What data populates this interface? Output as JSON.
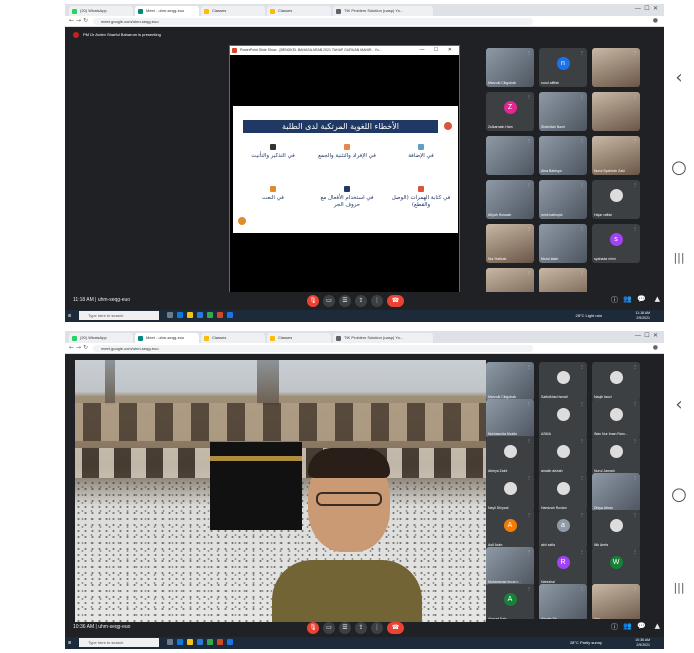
{
  "android_nav": {
    "back": "‹",
    "home": "○",
    "recents": "|||"
  },
  "top": {
    "tabs": [
      {
        "label": "(20) WhatsApp",
        "color": "#25d366"
      },
      {
        "label": "Meet - uhm-seqg-euo",
        "color": "#00897b"
      },
      {
        "label": "Classes",
        "color": "#fbbc04"
      },
      {
        "label": "Classes",
        "color": "#fbbc04"
      },
      {
        "label": "TIK Problem Solution (uasp) Yo...",
        "color": "#5f6368"
      }
    ],
    "url": "meet.google.com/uhm-seqg-euo",
    "banner": "PM Dr Arden Sharful Baharum is presenting",
    "ppt_title": "PowerPoint Slide Show - [BENGKEL BAHASA ARAB 2021 TAHAP GURUAN MAHIR - Yo...",
    "ppt_controls": "— ☐ ✕",
    "slide": {
      "title": "الأخطاء اللغوية المرتكبة لدى الطلبة",
      "items": [
        {
          "text": "في الإضافة",
          "color": "#5fa0c7"
        },
        {
          "text": "في الإفراد والتثنية والجمع",
          "color": "#e8844c"
        },
        {
          "text": "في التذكير والتأنيث",
          "color": "#333333"
        },
        {
          "text": "في كتابة الهمزات (الوصل والقطع)",
          "color": "#d8563a"
        },
        {
          "text": "في استخدام الأفعال مع حروف الجر",
          "color": "#1f3864"
        },
        {
          "text": "في النعت",
          "color": "#e08b2e"
        }
      ]
    },
    "participants": [
      {
        "name": "Marzuki Cikgubab",
        "type": "photo"
      },
      {
        "name": "nurul.alfifah",
        "type": "avatar",
        "initial": "n",
        "color": "#1a73e8"
      },
      {
        "name": "",
        "type": "cam"
      },
      {
        "name": "Zulkarnain Ham",
        "type": "avatar",
        "initial": "Z",
        "color": "#e52592"
      },
      {
        "name": "Shahidah Nazri",
        "type": "photo"
      },
      {
        "name": "",
        "type": "cam"
      },
      {
        "name": "",
        "type": "photo"
      },
      {
        "name": "Aina Batrisya",
        "type": "photo"
      },
      {
        "name": "Nurul Syahirah Zaki",
        "type": "cam"
      },
      {
        "name": "Atiyah Hussain",
        "type": "photo"
      },
      {
        "name": "mimi batrisyia",
        "type": "photo"
      },
      {
        "name": "Hajar raffan",
        "type": "face"
      },
      {
        "name": "Nur Hafizah",
        "type": "cam"
      },
      {
        "name": "Mohd latah",
        "type": "photo"
      },
      {
        "name": "syahada mimi",
        "type": "avatar",
        "initial": "s",
        "color": "#a142f4"
      },
      {
        "name": "Sharifah Roslani",
        "type": "cam"
      },
      {
        "name": "You",
        "type": "cam"
      }
    ],
    "time": "11:18 AM",
    "meeting_code": "uhm-seqg-euo",
    "taskbar": {
      "search": "Type here to search",
      "weather": "28°C Light rain",
      "clock_time": "11:18 AM",
      "clock_date": "2/9/2021"
    }
  },
  "bottom": {
    "tabs": [
      {
        "label": "(20) WhatsApp",
        "color": "#25d366"
      },
      {
        "label": "Meet - uhm-seqg-euo",
        "color": "#00897b"
      },
      {
        "label": "Classes",
        "color": "#fbbc04"
      },
      {
        "label": "Classes",
        "color": "#fbbc04"
      },
      {
        "label": "TIK Problem Solution (uasp) Yo...",
        "color": "#5f6368"
      }
    ],
    "url": "meet.google.com/uhm-seqg-euo",
    "participants": [
      {
        "name": "Marzuki Cikgubab",
        "type": "photo"
      },
      {
        "name": "Saifulbhari Ismail",
        "type": "face"
      },
      {
        "name": "Naqib fauzi",
        "type": "face"
      },
      {
        "name": "Norhasnida Moidin",
        "type": "photo"
      },
      {
        "name": "ASMA",
        "type": "face"
      },
      {
        "name": "Wan Nur Iman Ram...",
        "type": "face"
      },
      {
        "name": "Aleeya Zaini",
        "type": "face"
      },
      {
        "name": "amalin aishah",
        "type": "face"
      },
      {
        "name": "Nurul Jannah",
        "type": "face"
      },
      {
        "name": "Nayli Dhiyaul",
        "type": "face"
      },
      {
        "name": "Hamizah Ruslan",
        "type": "face"
      },
      {
        "name": "Dhiya Afnan",
        "type": "photo"
      },
      {
        "name": "Asif Aslm",
        "type": "avatar",
        "initial": "A",
        "color": "#f57c00"
      },
      {
        "name": "atiri zafia",
        "type": "avatar",
        "initial": "a",
        "color": "#8e9aa6"
      },
      {
        "name": "Nik Aerfa",
        "type": "face"
      },
      {
        "name": "Muhammad Imran I...",
        "type": "photo"
      },
      {
        "name": "Nabiahal",
        "type": "avatar",
        "initial": "R",
        "color": "#a142f4"
      },
      {
        "name": "",
        "type": "avatar",
        "initial": "W",
        "color": "#188038"
      },
      {
        "name": "Ahmad Fais",
        "type": "avatar",
        "initial": "A",
        "color": "#188038"
      },
      {
        "name": "Aisyah Sir",
        "type": "photo"
      },
      {
        "name": "You",
        "type": "cam"
      }
    ],
    "time": "10:36 AM",
    "meeting_code": "uhm-seqg-euo",
    "taskbar": {
      "search": "Type here to search",
      "weather": "28°C Partly sunny",
      "clock_time": "10:36 AM",
      "clock_date": "2/9/2021"
    }
  }
}
